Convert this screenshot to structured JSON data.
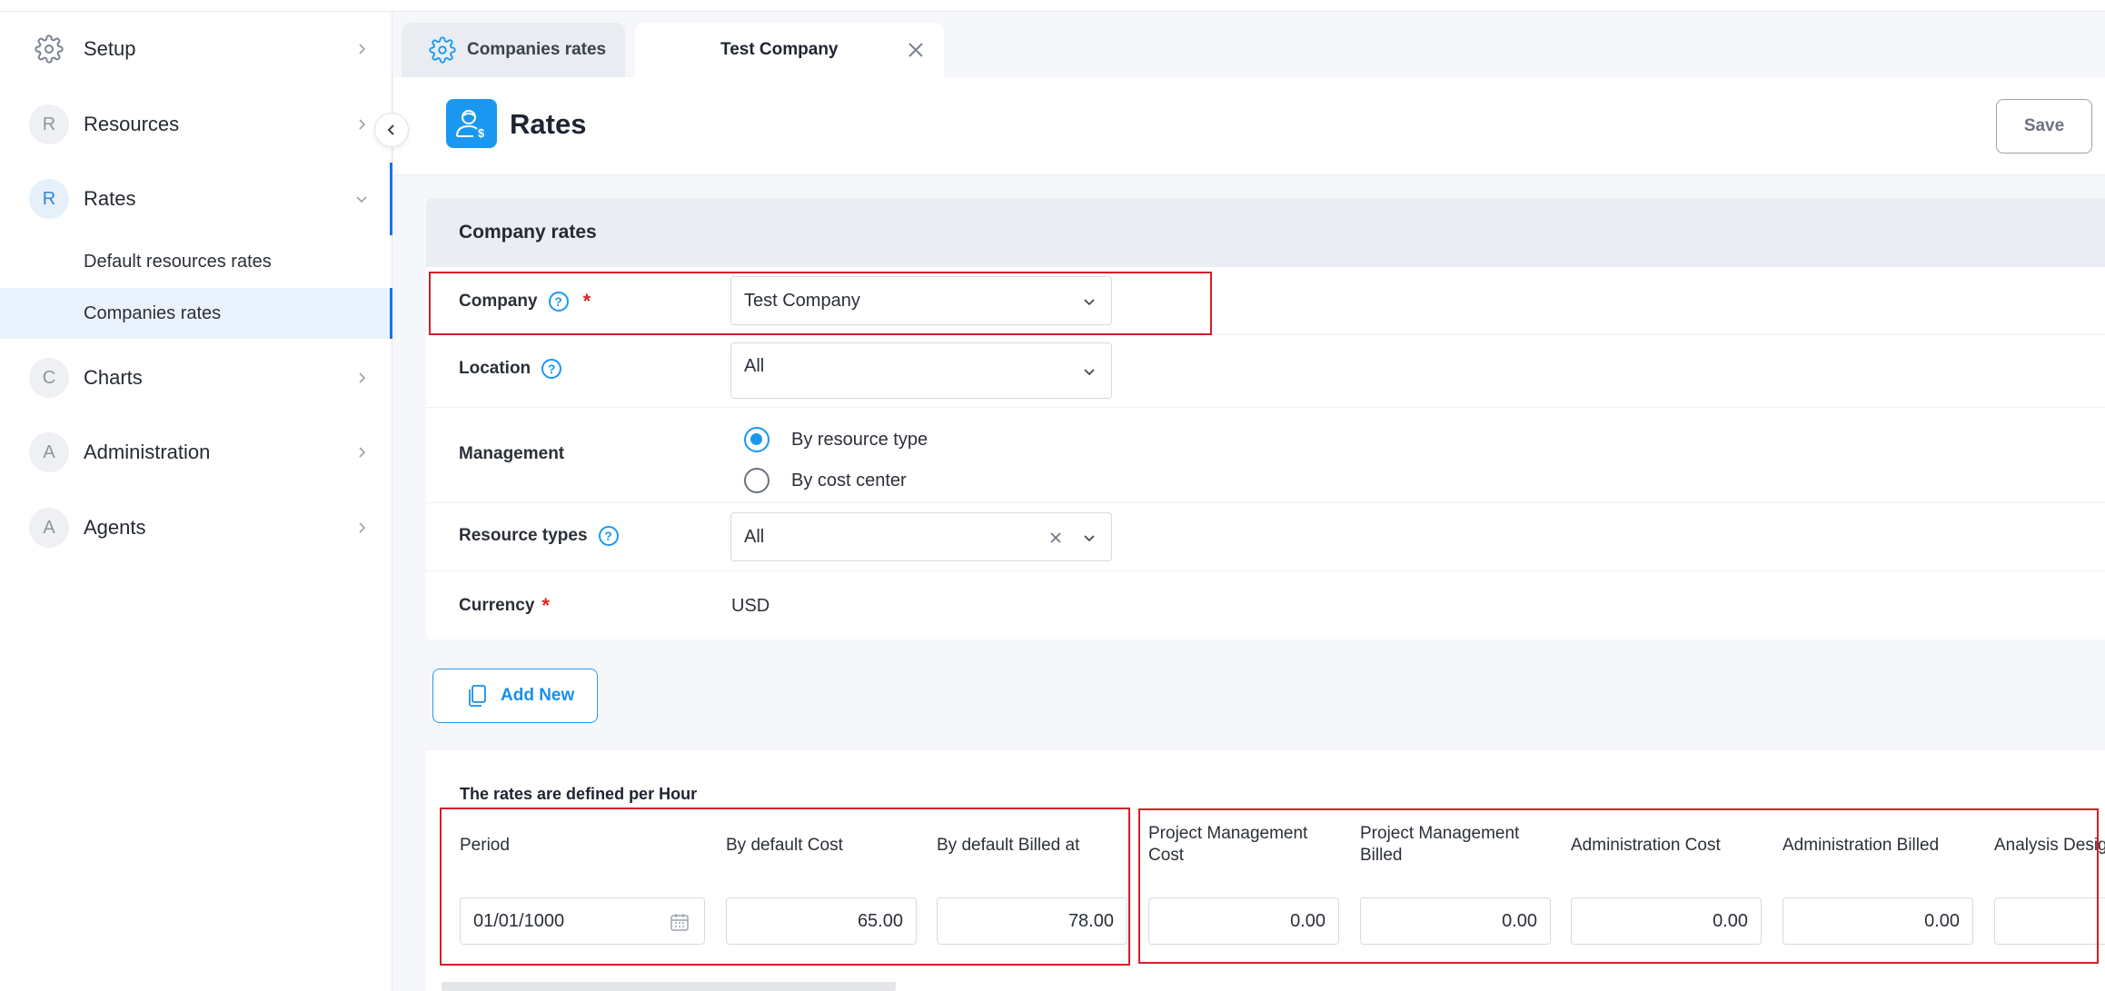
{
  "sidebar": {
    "items": [
      {
        "letter": "",
        "label": "Setup"
      },
      {
        "letter": "R",
        "label": "Resources"
      },
      {
        "letter": "R",
        "label": "Rates"
      },
      {
        "letter": "C",
        "label": "Charts"
      },
      {
        "letter": "A",
        "label": "Administration"
      },
      {
        "letter": "A",
        "label": "Agents"
      }
    ],
    "rates_subitems": [
      {
        "label": "Default resources rates"
      },
      {
        "label": "Companies rates"
      }
    ]
  },
  "tabs": [
    {
      "label": "Companies rates"
    },
    {
      "label": "Test Company"
    }
  ],
  "header": {
    "title": "Rates",
    "save_label": "Save"
  },
  "form": {
    "section_title": "Company rates",
    "company": {
      "label": "Company",
      "value": "Test Company"
    },
    "location": {
      "label": "Location",
      "value": "All"
    },
    "management": {
      "label": "Management",
      "options": [
        {
          "label": "By resource type",
          "selected": true
        },
        {
          "label": "By cost center",
          "selected": false
        }
      ]
    },
    "resource_types": {
      "label": "Resource types",
      "value": "All"
    },
    "currency": {
      "label": "Currency",
      "value": "USD"
    }
  },
  "add_new_label": "Add New",
  "grid": {
    "caption": "The rates are defined per Hour",
    "columns": [
      {
        "header": "Period",
        "value": "01/01/1000"
      },
      {
        "header": "By default Cost",
        "value": "65.00"
      },
      {
        "header": "By default Billed at",
        "value": "78.00"
      },
      {
        "header": "Project Management Cost",
        "value": "0.00"
      },
      {
        "header": "Project Management Billed",
        "value": "0.00"
      },
      {
        "header": "Administration Cost",
        "value": "0.00"
      },
      {
        "header": "Administration Billed",
        "value": "0.00"
      },
      {
        "header": "Analysis Desig",
        "value": ""
      }
    ]
  },
  "colors": {
    "accent": "#1a98f0",
    "highlight": "#d61f26",
    "required": "#e02020"
  }
}
